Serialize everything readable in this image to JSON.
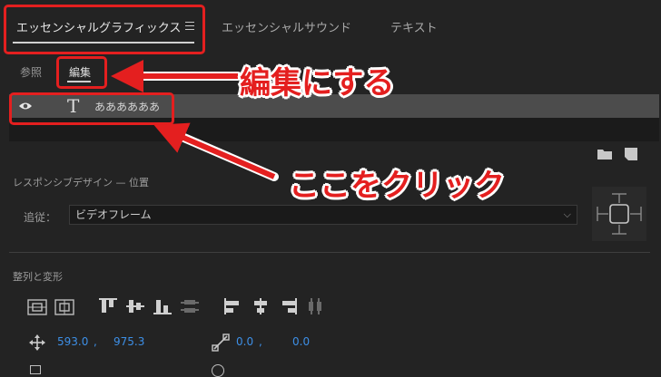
{
  "tabs": [
    {
      "label": "エッセンシャルグラフィックス",
      "active": true
    },
    {
      "label": "エッセンシャルサウンド",
      "active": false
    },
    {
      "label": "テキスト",
      "active": false
    }
  ],
  "subtabs": [
    {
      "label": "参照",
      "active": false
    },
    {
      "label": "編集",
      "active": true
    }
  ],
  "layer": {
    "name": "ああああああ",
    "icon": "eye-icon",
    "type_icon": "text-T-icon"
  },
  "responsive": {
    "title": "レスポンシブデザイン — 位置",
    "follow_label": "追従：",
    "follow_value": "ビデオフレーム"
  },
  "align": {
    "title": "整列と変形"
  },
  "transform": {
    "pos_x": "593.0",
    "pos_y": "975.3",
    "sep": ",",
    "anchor_x": "0.0",
    "anchor_y": "0.0"
  },
  "annotations": {
    "edit": "編集にする",
    "click": "ここをクリック"
  },
  "colors": {
    "annotation_red": "#e41f1f",
    "value_blue": "#3d8fe6",
    "background": "#232323"
  }
}
